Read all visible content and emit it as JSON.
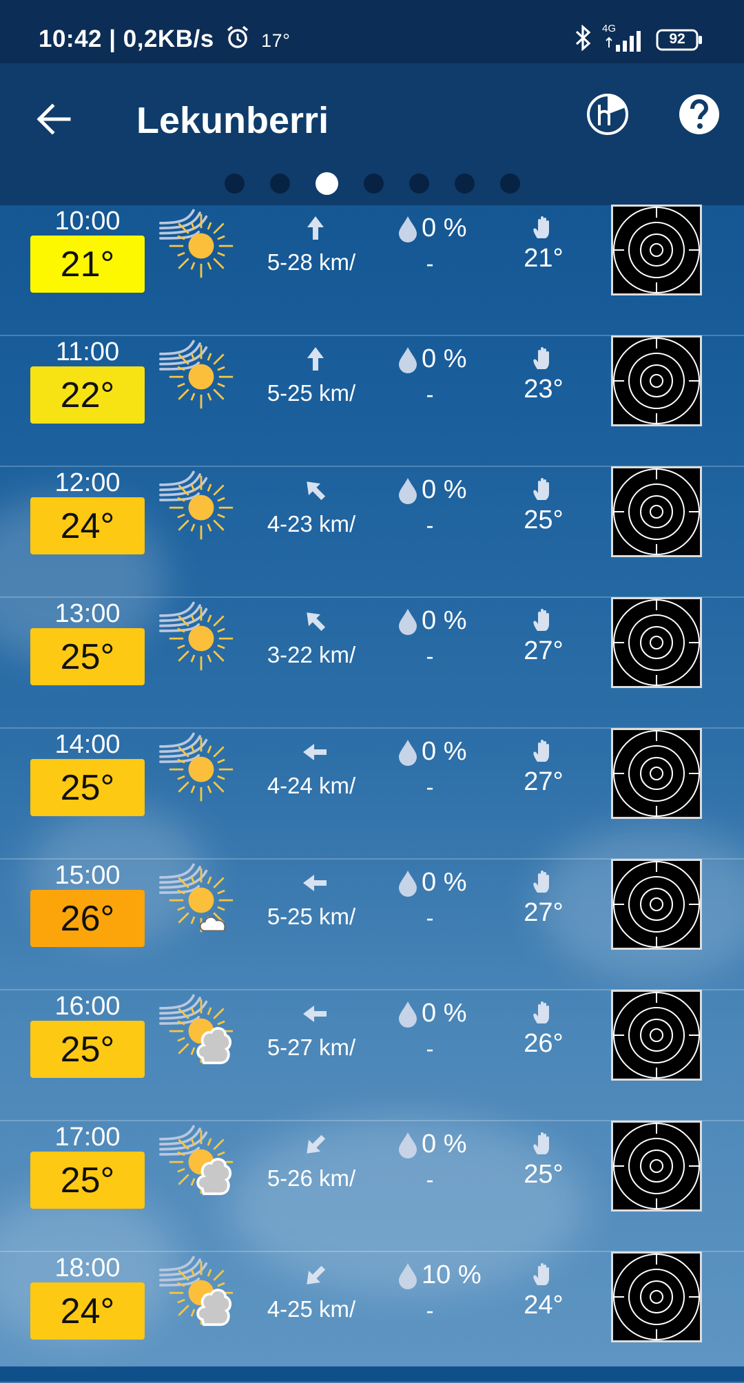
{
  "status_bar": {
    "time_speed": "10:42 | 0,2KB/s",
    "temp": "17°",
    "network": "4G",
    "battery": "92"
  },
  "header": {
    "title": "Lekunberri",
    "pages": 7,
    "active_page": 2
  },
  "rows": [
    {
      "time": "10:00",
      "temp": "21°",
      "temp_color": "#fdf800",
      "icon": "sunny-windy",
      "wind_dir": "north",
      "wind": "5-28 km/",
      "precip": "0 %",
      "precip_amount": "-",
      "feels": "21°"
    },
    {
      "time": "11:00",
      "temp": "22°",
      "temp_color": "#f7e214",
      "icon": "sunny-windy",
      "wind_dir": "north",
      "wind": "5-25 km/",
      "precip": "0 %",
      "precip_amount": "-",
      "feels": "23°"
    },
    {
      "time": "12:00",
      "temp": "24°",
      "temp_color": "#fdc913",
      "icon": "sunny-windy",
      "wind_dir": "north-west",
      "wind": "4-23 km/",
      "precip": "0 %",
      "precip_amount": "-",
      "feels": "25°"
    },
    {
      "time": "13:00",
      "temp": "25°",
      "temp_color": "#fdc913",
      "icon": "sunny-windy",
      "wind_dir": "north-west",
      "wind": "3-22 km/",
      "precip": "0 %",
      "precip_amount": "-",
      "feels": "27°"
    },
    {
      "time": "14:00",
      "temp": "25°",
      "temp_color": "#fdc913",
      "icon": "sunny-windy",
      "wind_dir": "west",
      "wind": "4-24 km/",
      "precip": "0 %",
      "precip_amount": "-",
      "feels": "27°"
    },
    {
      "time": "15:00",
      "temp": "26°",
      "temp_color": "#fca50b",
      "icon": "sun-small-cloud-windy",
      "wind_dir": "west",
      "wind": "5-25 km/",
      "precip": "0 %",
      "precip_amount": "-",
      "feels": "27°"
    },
    {
      "time": "16:00",
      "temp": "25°",
      "temp_color": "#fdc913",
      "icon": "sun-cloud-windy",
      "wind_dir": "west",
      "wind": "5-27 km/",
      "precip": "0 %",
      "precip_amount": "-",
      "feels": "26°"
    },
    {
      "time": "17:00",
      "temp": "25°",
      "temp_color": "#fdc913",
      "icon": "sun-cloud-windy",
      "wind_dir": "south-west",
      "wind": "5-26 km/",
      "precip": "0 %",
      "precip_amount": "-",
      "feels": "25°"
    },
    {
      "time": "18:00",
      "temp": "24°",
      "temp_color": "#fdc913",
      "icon": "sun-cloud-windy",
      "wind_dir": "south-west",
      "wind": "4-25 km/",
      "precip": "10 %",
      "precip_amount": "-",
      "feels": "24°"
    }
  ]
}
